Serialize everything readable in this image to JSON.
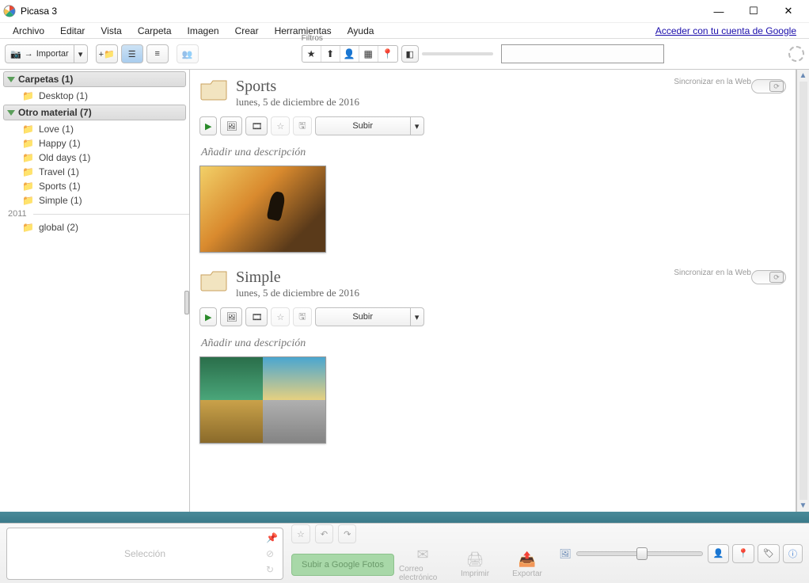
{
  "title": "Picasa 3",
  "login_link": "Acceder con tu cuenta de Google",
  "menu": [
    "Archivo",
    "Editar",
    "Vista",
    "Carpeta",
    "Imagen",
    "Crear",
    "Herramientas",
    "Ayuda"
  ],
  "toolbar": {
    "import": "Importar",
    "filters_label": "Filtros"
  },
  "sidebar": {
    "sections": [
      {
        "title": "Carpetas (1)",
        "items": [
          {
            "label": "Desktop (1)"
          }
        ]
      },
      {
        "title": "Otro material (7)",
        "items": [
          {
            "label": "Love (1)"
          },
          {
            "label": "Happy (1)"
          },
          {
            "label": "Old days (1)"
          },
          {
            "label": "Travel (1)"
          },
          {
            "label": "Sports (1)"
          },
          {
            "label": "Simple (1)"
          }
        ],
        "year_groups": [
          {
            "year": "2011",
            "items": [
              {
                "label": "global (2)"
              }
            ]
          }
        ]
      }
    ]
  },
  "albums": [
    {
      "name": "Sports",
      "date": "lunes, 5 de diciembre de 2016",
      "sync": "Sincronizar en la Web",
      "upload": "Subir",
      "desc": "Añadir una descripción",
      "thumb": "sports"
    },
    {
      "name": "Simple",
      "date": "lunes, 5 de diciembre de 2016",
      "sync": "Sincronizar en la Web",
      "upload": "Subir",
      "desc": "Añadir una descripción",
      "thumb": "simple"
    }
  ],
  "footer": {
    "selection": "Selección",
    "google_upload": "Subir a Google Fotos",
    "actions": [
      "Correo electrónico",
      "Imprimir",
      "Exportar"
    ]
  }
}
